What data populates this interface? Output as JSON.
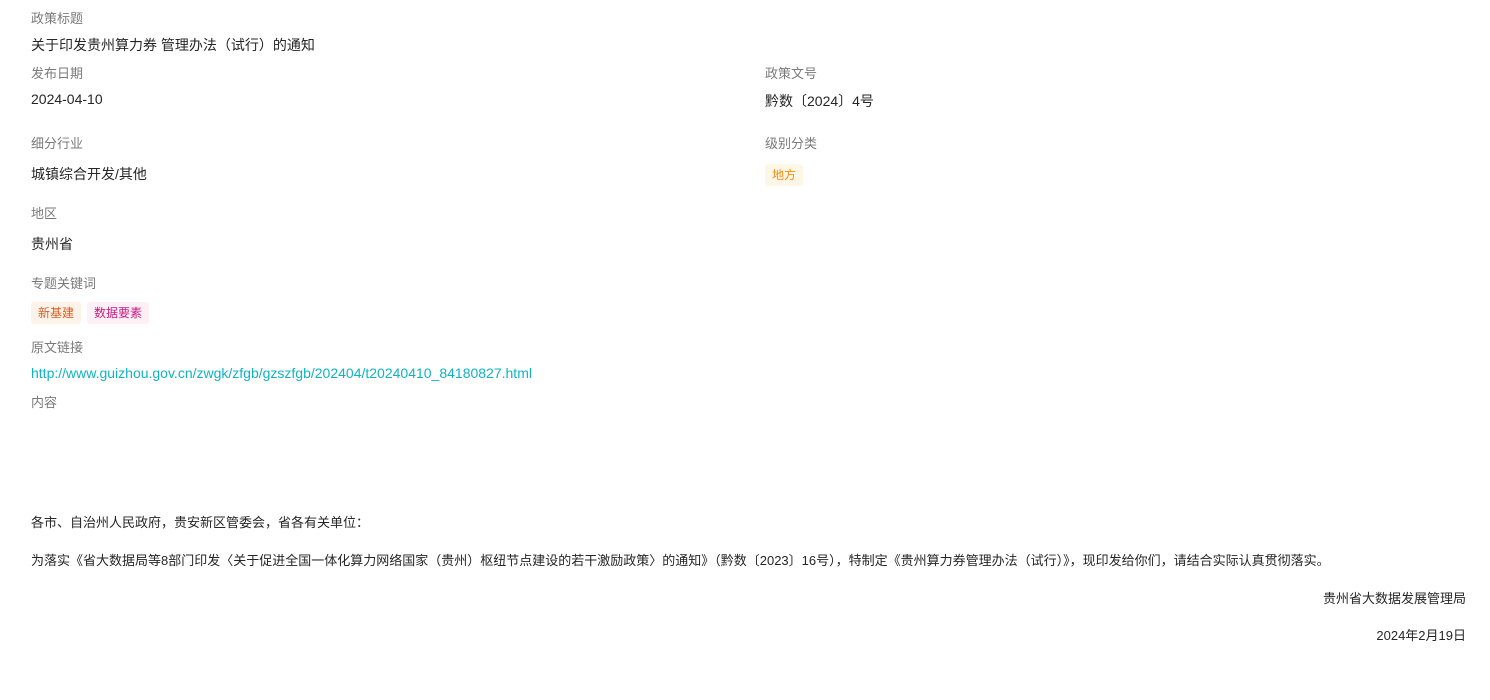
{
  "policy_title": {
    "label": "政策标题",
    "value": "关于印发贵州算力券  管理办法（试行）的通知"
  },
  "publish_date": {
    "label": "发布日期",
    "value": "2024-04-10"
  },
  "doc_number": {
    "label": "政策文号",
    "value": "黔数〔2024〕4号"
  },
  "industry": {
    "label": "细分行业",
    "value": "城镇综合开发/其他"
  },
  "level": {
    "label": "级别分类",
    "tag": "地方"
  },
  "region": {
    "label": "地区",
    "value": "贵州省"
  },
  "keywords": {
    "label": "专题关键词",
    "tags": [
      "新基建",
      "数据要素"
    ]
  },
  "source_link": {
    "label": "原文链接",
    "url": "http://www.guizhou.gov.cn/zwgk/zfgb/gzszfgb/202404/t20240410_84180827.html"
  },
  "content": {
    "label": "内容",
    "salutation": "各市、自治州人民政府，贵安新区管委会，省各有关单位：",
    "body": "为落实《省大数据局等8部门印发〈关于促进全国一体化算力网络国家（贵州）枢纽节点建设的若干激励政策〉的通知》（黔数〔2023〕16号），特制定《贵州算力券管理办法（试行）》，现印发给你们，请结合实际认真贯彻落实。",
    "issuer": "贵州省大数据发展管理局",
    "date": "2024年2月19日"
  },
  "colors": {
    "link": "#13b2c3",
    "tag_level": "#fa8c16",
    "tag_keyword_1": "#d4622a",
    "tag_keyword_2": "#c41d7f"
  }
}
